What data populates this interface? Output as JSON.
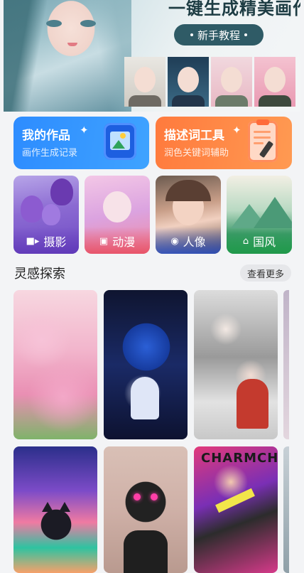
{
  "hero": {
    "title": "一键生成精美画作",
    "button_label": "新手教程"
  },
  "tools": [
    {
      "title": "我的作品",
      "subtitle": "画作生成记录",
      "icon": "gallery-icon"
    },
    {
      "title": "描述词工具",
      "subtitle": "润色关键词辅助",
      "icon": "clipboard-pencil-icon"
    }
  ],
  "categories": [
    {
      "label": "摄影",
      "icon": "video-camera-icon"
    },
    {
      "label": "动漫",
      "icon": "image-icon"
    },
    {
      "label": "人像",
      "icon": "portrait-icon"
    },
    {
      "label": "国风",
      "icon": "pavilion-icon"
    }
  ],
  "section": {
    "title": "灵感探索",
    "more_label": "查看更多"
  },
  "gallery_texts": {
    "poster_text": "CHARMCH"
  },
  "colors": {
    "tool_blue": "#2d8cff",
    "tool_orange": "#ff7a3d",
    "hero_button": "#2f5b66"
  }
}
